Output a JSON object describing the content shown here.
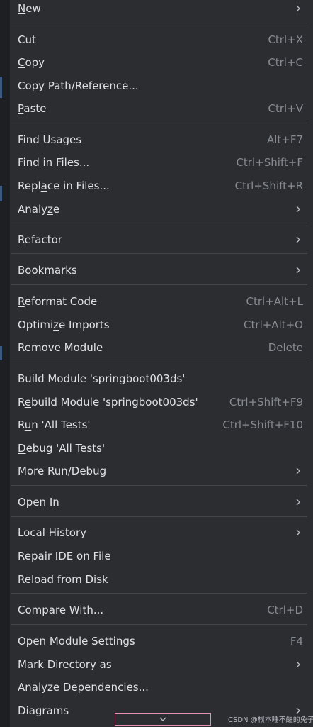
{
  "menu": {
    "items": [
      {
        "id": "new",
        "parts": [
          [
            "",
            "N",
            "ew"
          ]
        ],
        "shortcut": "",
        "submenu": true
      },
      {
        "id": "cut",
        "parts": [
          [
            "Cu",
            "t",
            ""
          ]
        ],
        "shortcut": "Ctrl+X",
        "submenu": false
      },
      {
        "id": "copy",
        "parts": [
          [
            "",
            "C",
            "opy"
          ]
        ],
        "shortcut": "Ctrl+C",
        "submenu": false
      },
      {
        "id": "copy-path",
        "parts": [
          [
            "Copy Path/Reference...",
            "",
            ""
          ]
        ],
        "shortcut": "",
        "submenu": false
      },
      {
        "id": "paste",
        "parts": [
          [
            "",
            "P",
            "aste"
          ]
        ],
        "shortcut": "Ctrl+V",
        "submenu": false
      },
      {
        "id": "find-usages",
        "parts": [
          [
            "Find ",
            "U",
            "sages"
          ]
        ],
        "shortcut": "Alt+F7",
        "submenu": false
      },
      {
        "id": "find-in-files",
        "parts": [
          [
            "Find in Files...",
            "",
            ""
          ]
        ],
        "shortcut": "Ctrl+Shift+F",
        "submenu": false
      },
      {
        "id": "replace-in-files",
        "parts": [
          [
            "Repl",
            "a",
            "ce in Files..."
          ]
        ],
        "shortcut": "Ctrl+Shift+R",
        "submenu": false
      },
      {
        "id": "analyze",
        "parts": [
          [
            "Analy",
            "z",
            "e"
          ]
        ],
        "shortcut": "",
        "submenu": true
      },
      {
        "id": "refactor",
        "parts": [
          [
            "",
            "R",
            "efactor"
          ]
        ],
        "shortcut": "",
        "submenu": true
      },
      {
        "id": "bookmarks",
        "parts": [
          [
            "Bookmarks",
            "",
            ""
          ]
        ],
        "shortcut": "",
        "submenu": true
      },
      {
        "id": "reformat-code",
        "parts": [
          [
            "",
            "R",
            "eformat Code"
          ]
        ],
        "shortcut": "Ctrl+Alt+L",
        "submenu": false
      },
      {
        "id": "optimize-imports",
        "parts": [
          [
            "Optimi",
            "z",
            "e Imports"
          ]
        ],
        "shortcut": "Ctrl+Alt+O",
        "submenu": false
      },
      {
        "id": "remove-module",
        "parts": [
          [
            "Remove Module",
            "",
            ""
          ]
        ],
        "shortcut": "Delete",
        "submenu": false
      },
      {
        "id": "build-module",
        "parts": [
          [
            "Build ",
            "M",
            "odule 'springboot003ds'"
          ]
        ],
        "shortcut": "",
        "submenu": false
      },
      {
        "id": "rebuild-module",
        "parts": [
          [
            "R",
            "e",
            "build Module 'springboot003ds'"
          ]
        ],
        "shortcut": "Ctrl+Shift+F9",
        "submenu": false
      },
      {
        "id": "run-all-tests",
        "parts": [
          [
            "R",
            "u",
            "n 'All Tests'"
          ]
        ],
        "shortcut": "Ctrl+Shift+F10",
        "submenu": false
      },
      {
        "id": "debug-all-tests",
        "parts": [
          [
            "",
            "D",
            "ebug 'All Tests'"
          ]
        ],
        "shortcut": "",
        "submenu": false
      },
      {
        "id": "more-run-debug",
        "parts": [
          [
            "More Run/Debug",
            "",
            ""
          ]
        ],
        "shortcut": "",
        "submenu": true
      },
      {
        "id": "open-in",
        "parts": [
          [
            "Open In",
            "",
            ""
          ]
        ],
        "shortcut": "",
        "submenu": true
      },
      {
        "id": "local-history",
        "parts": [
          [
            "Local ",
            "H",
            "istory"
          ]
        ],
        "shortcut": "",
        "submenu": true
      },
      {
        "id": "repair-ide",
        "parts": [
          [
            "Repair IDE on File",
            "",
            ""
          ]
        ],
        "shortcut": "",
        "submenu": false
      },
      {
        "id": "reload-from-disk",
        "parts": [
          [
            "Reload from Disk",
            "",
            ""
          ]
        ],
        "shortcut": "",
        "submenu": false
      },
      {
        "id": "compare-with",
        "parts": [
          [
            "Compare With...",
            "",
            ""
          ]
        ],
        "shortcut": "Ctrl+D",
        "submenu": false
      },
      {
        "id": "open-module-settings",
        "parts": [
          [
            "Open Module Settings",
            "",
            ""
          ]
        ],
        "shortcut": "F4",
        "submenu": false
      },
      {
        "id": "mark-directory-as",
        "parts": [
          [
            "Mark Directory as",
            "",
            ""
          ]
        ],
        "shortcut": "",
        "submenu": true
      },
      {
        "id": "analyze-dependencies",
        "parts": [
          [
            "Analyze Dependencies...",
            "",
            ""
          ]
        ],
        "shortcut": "",
        "submenu": false
      },
      {
        "id": "diagrams",
        "parts": [
          [
            "Diagrams",
            "",
            ""
          ]
        ],
        "shortcut": "",
        "submenu": true
      }
    ]
  },
  "icons": {
    "submenu": "chevron-right-icon",
    "scroll": "chevron-down-icon"
  },
  "watermark": "CSDN @根本睡不醒的兔子",
  "colors": {
    "background": "#2b2d30",
    "text": "#dfe1e5",
    "shortcut": "#868a91",
    "separator": "#43454a",
    "highlight_box": "#e58fb3"
  }
}
